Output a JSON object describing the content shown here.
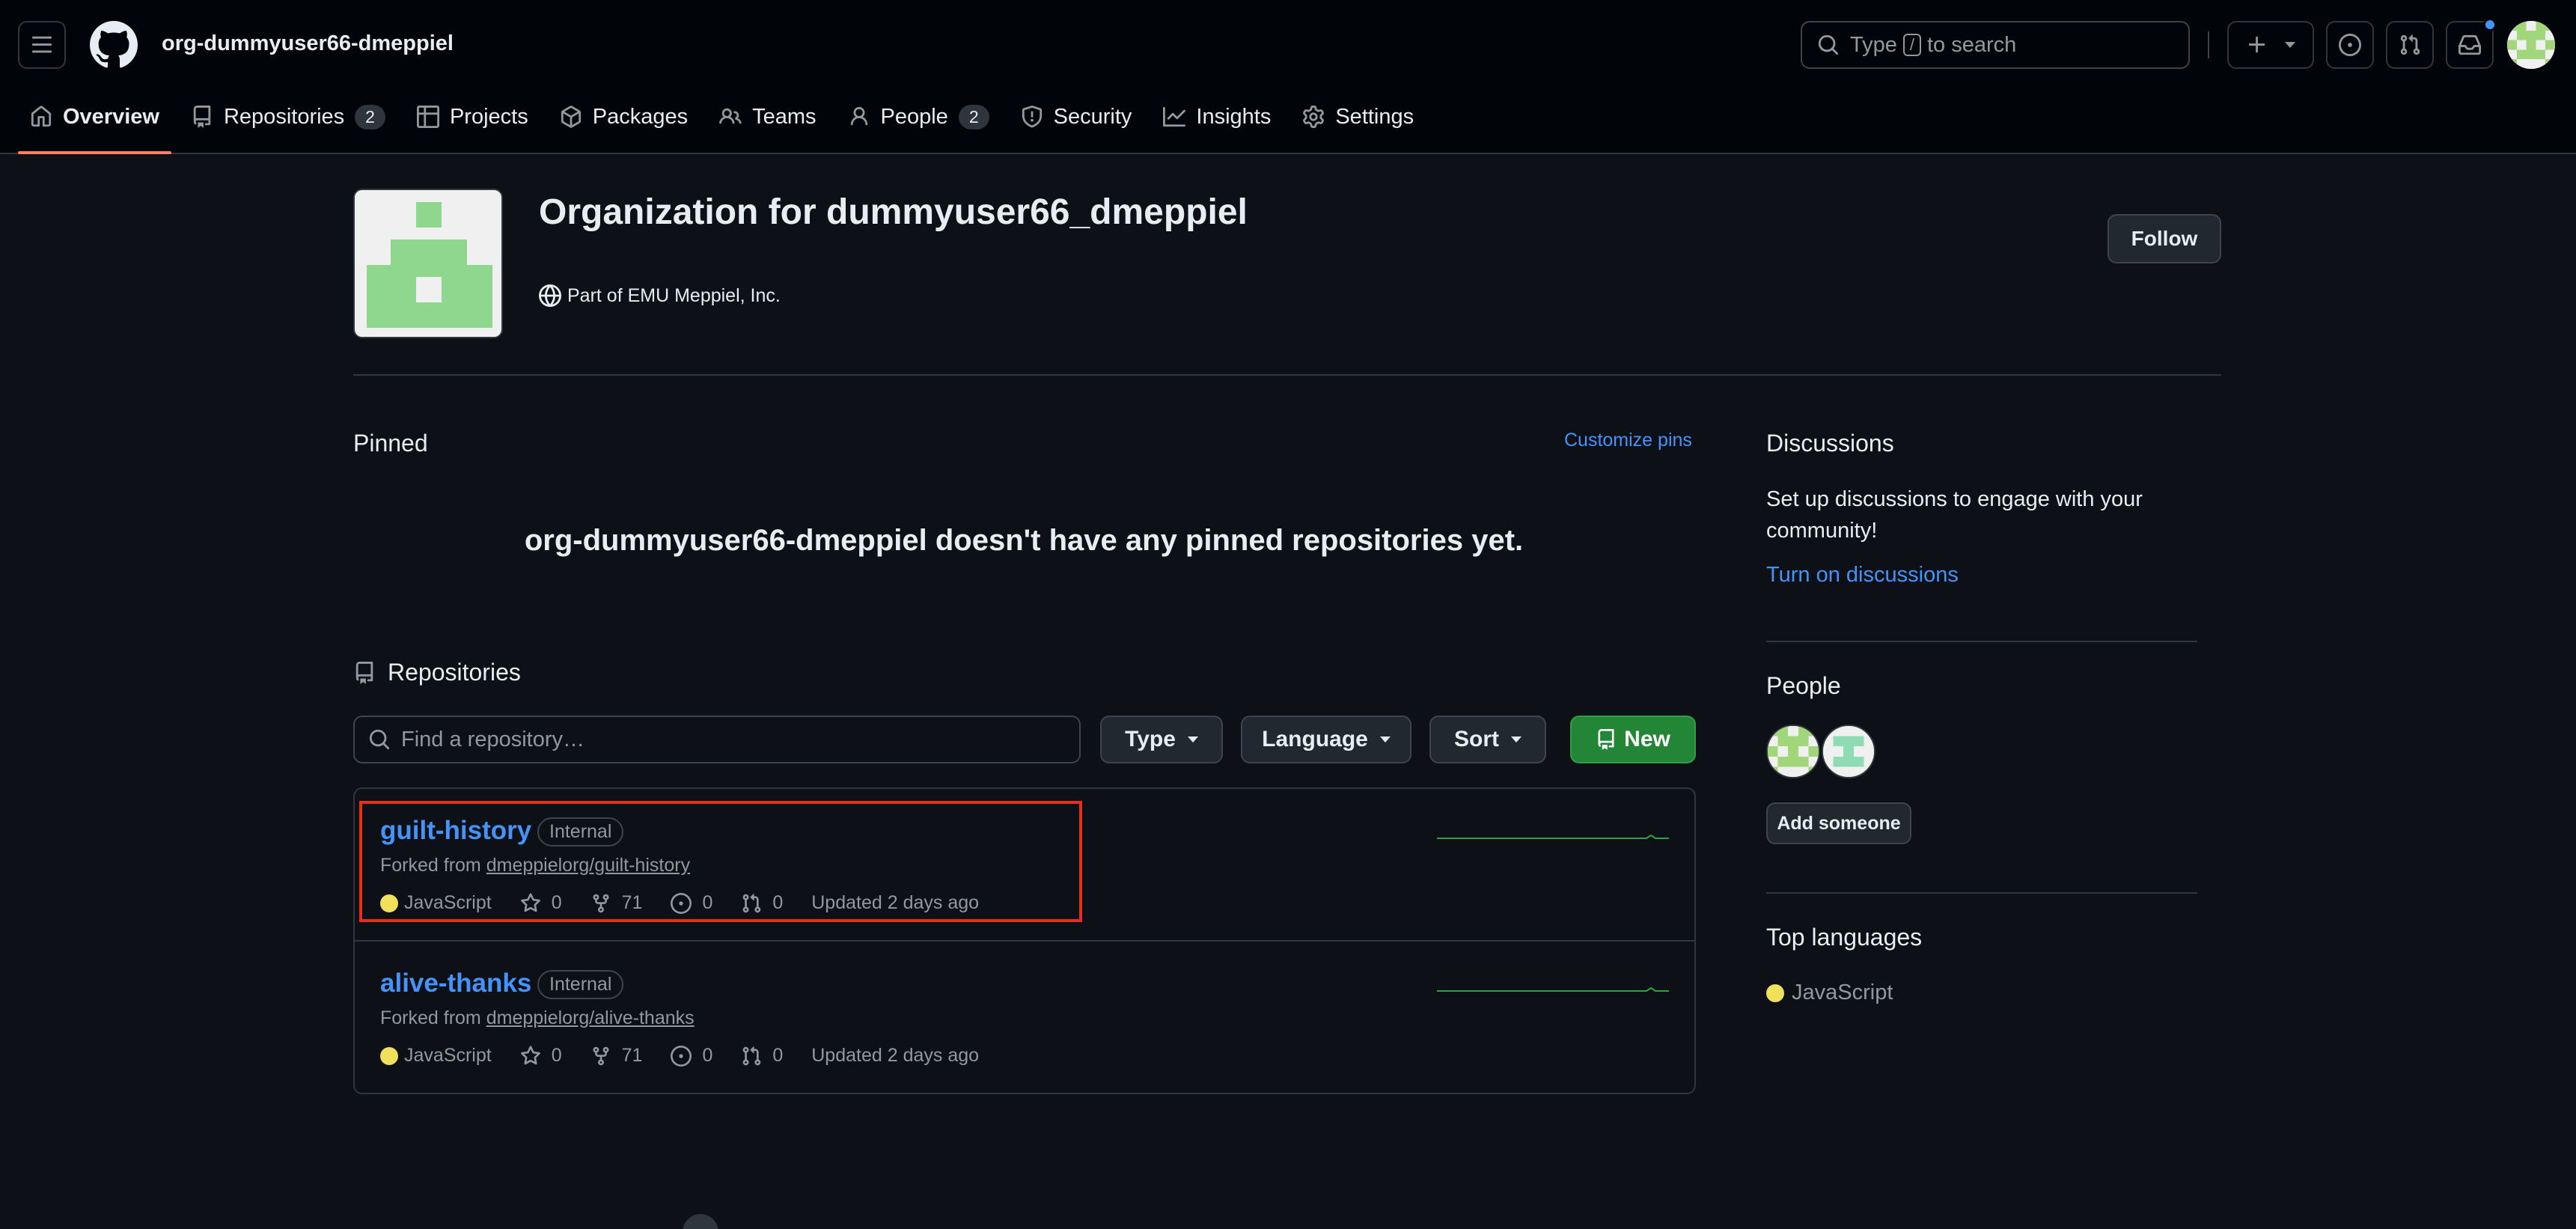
{
  "header": {
    "org_name": "org-dummyuser66-dmeppiel",
    "search": {
      "prefix": "Type",
      "key": "/",
      "suffix": "to search"
    }
  },
  "nav": {
    "overview": "Overview",
    "repositories": "Repositories",
    "repositories_count": "2",
    "projects": "Projects",
    "packages": "Packages",
    "teams": "Teams",
    "people": "People",
    "people_count": "2",
    "security": "Security",
    "insights": "Insights",
    "settings": "Settings"
  },
  "org": {
    "title": "Organization for dummyuser66_dmeppiel",
    "part_of": "Part of EMU Meppiel, Inc.",
    "follow_label": "Follow"
  },
  "pinned": {
    "title": "Pinned",
    "customize_label": "Customize pins",
    "empty_message": "org-dummyuser66-dmeppiel doesn't have any pinned repositories yet."
  },
  "repositories": {
    "title": "Repositories",
    "search_placeholder": "Find a repository…",
    "type_label": "Type",
    "language_label": "Language",
    "sort_label": "Sort",
    "new_label": "New",
    "items": [
      {
        "name": "guilt-history",
        "visibility": "Internal",
        "forked_prefix": "Forked from",
        "forked_from": "dmeppielorg/guilt-history",
        "language": "JavaScript",
        "stars": "0",
        "forks": "71",
        "issues": "0",
        "pulls": "0",
        "updated": "Updated 2 days ago"
      },
      {
        "name": "alive-thanks",
        "visibility": "Internal",
        "forked_prefix": "Forked from",
        "forked_from": "dmeppielorg/alive-thanks",
        "language": "JavaScript",
        "stars": "0",
        "forks": "71",
        "issues": "0",
        "pulls": "0",
        "updated": "Updated 2 days ago"
      }
    ]
  },
  "sidebar": {
    "discussions_title": "Discussions",
    "discussions_text": "Set up discussions to engage with your community!",
    "discussions_link": "Turn on discussions",
    "people_title": "People",
    "add_someone_label": "Add someone",
    "top_languages_title": "Top languages",
    "top_language": "JavaScript"
  },
  "colors": {
    "accent_link": "#4493f8",
    "primary_button": "#238636",
    "javascript": "#f1e05a",
    "active_tab": "#f78166",
    "highlight_box": "#e0301e"
  }
}
